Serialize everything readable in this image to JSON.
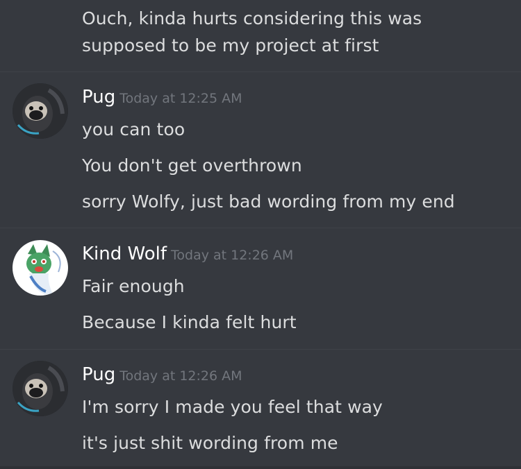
{
  "messages": {
    "m0": {
      "lines": [
        "Ouch, kinda hurts considering this was",
        "supposed to be my project at first"
      ]
    },
    "m1": {
      "author": "Pug",
      "timestamp": "Today at 12:25 AM",
      "avatar": "pug-avatar",
      "lines": [
        "you can too",
        "You don't get overthrown",
        "sorry Wolfy, just bad wording from my end"
      ]
    },
    "m2": {
      "author": "Kind Wolf",
      "timestamp": "Today at 12:26 AM",
      "avatar": "wolf-avatar",
      "lines": [
        "Fair enough",
        "Because I kinda felt hurt"
      ]
    },
    "m3": {
      "author": "Pug",
      "timestamp": "Today at 12:26 AM",
      "avatar": "pug-avatar",
      "lines": [
        "I'm sorry I made you feel that way",
        "it's just shit wording from me"
      ]
    }
  },
  "colors": {
    "background": "#36393f",
    "message_text": "#dcddde",
    "username": "#ffffff",
    "timestamp": "#72767d"
  }
}
